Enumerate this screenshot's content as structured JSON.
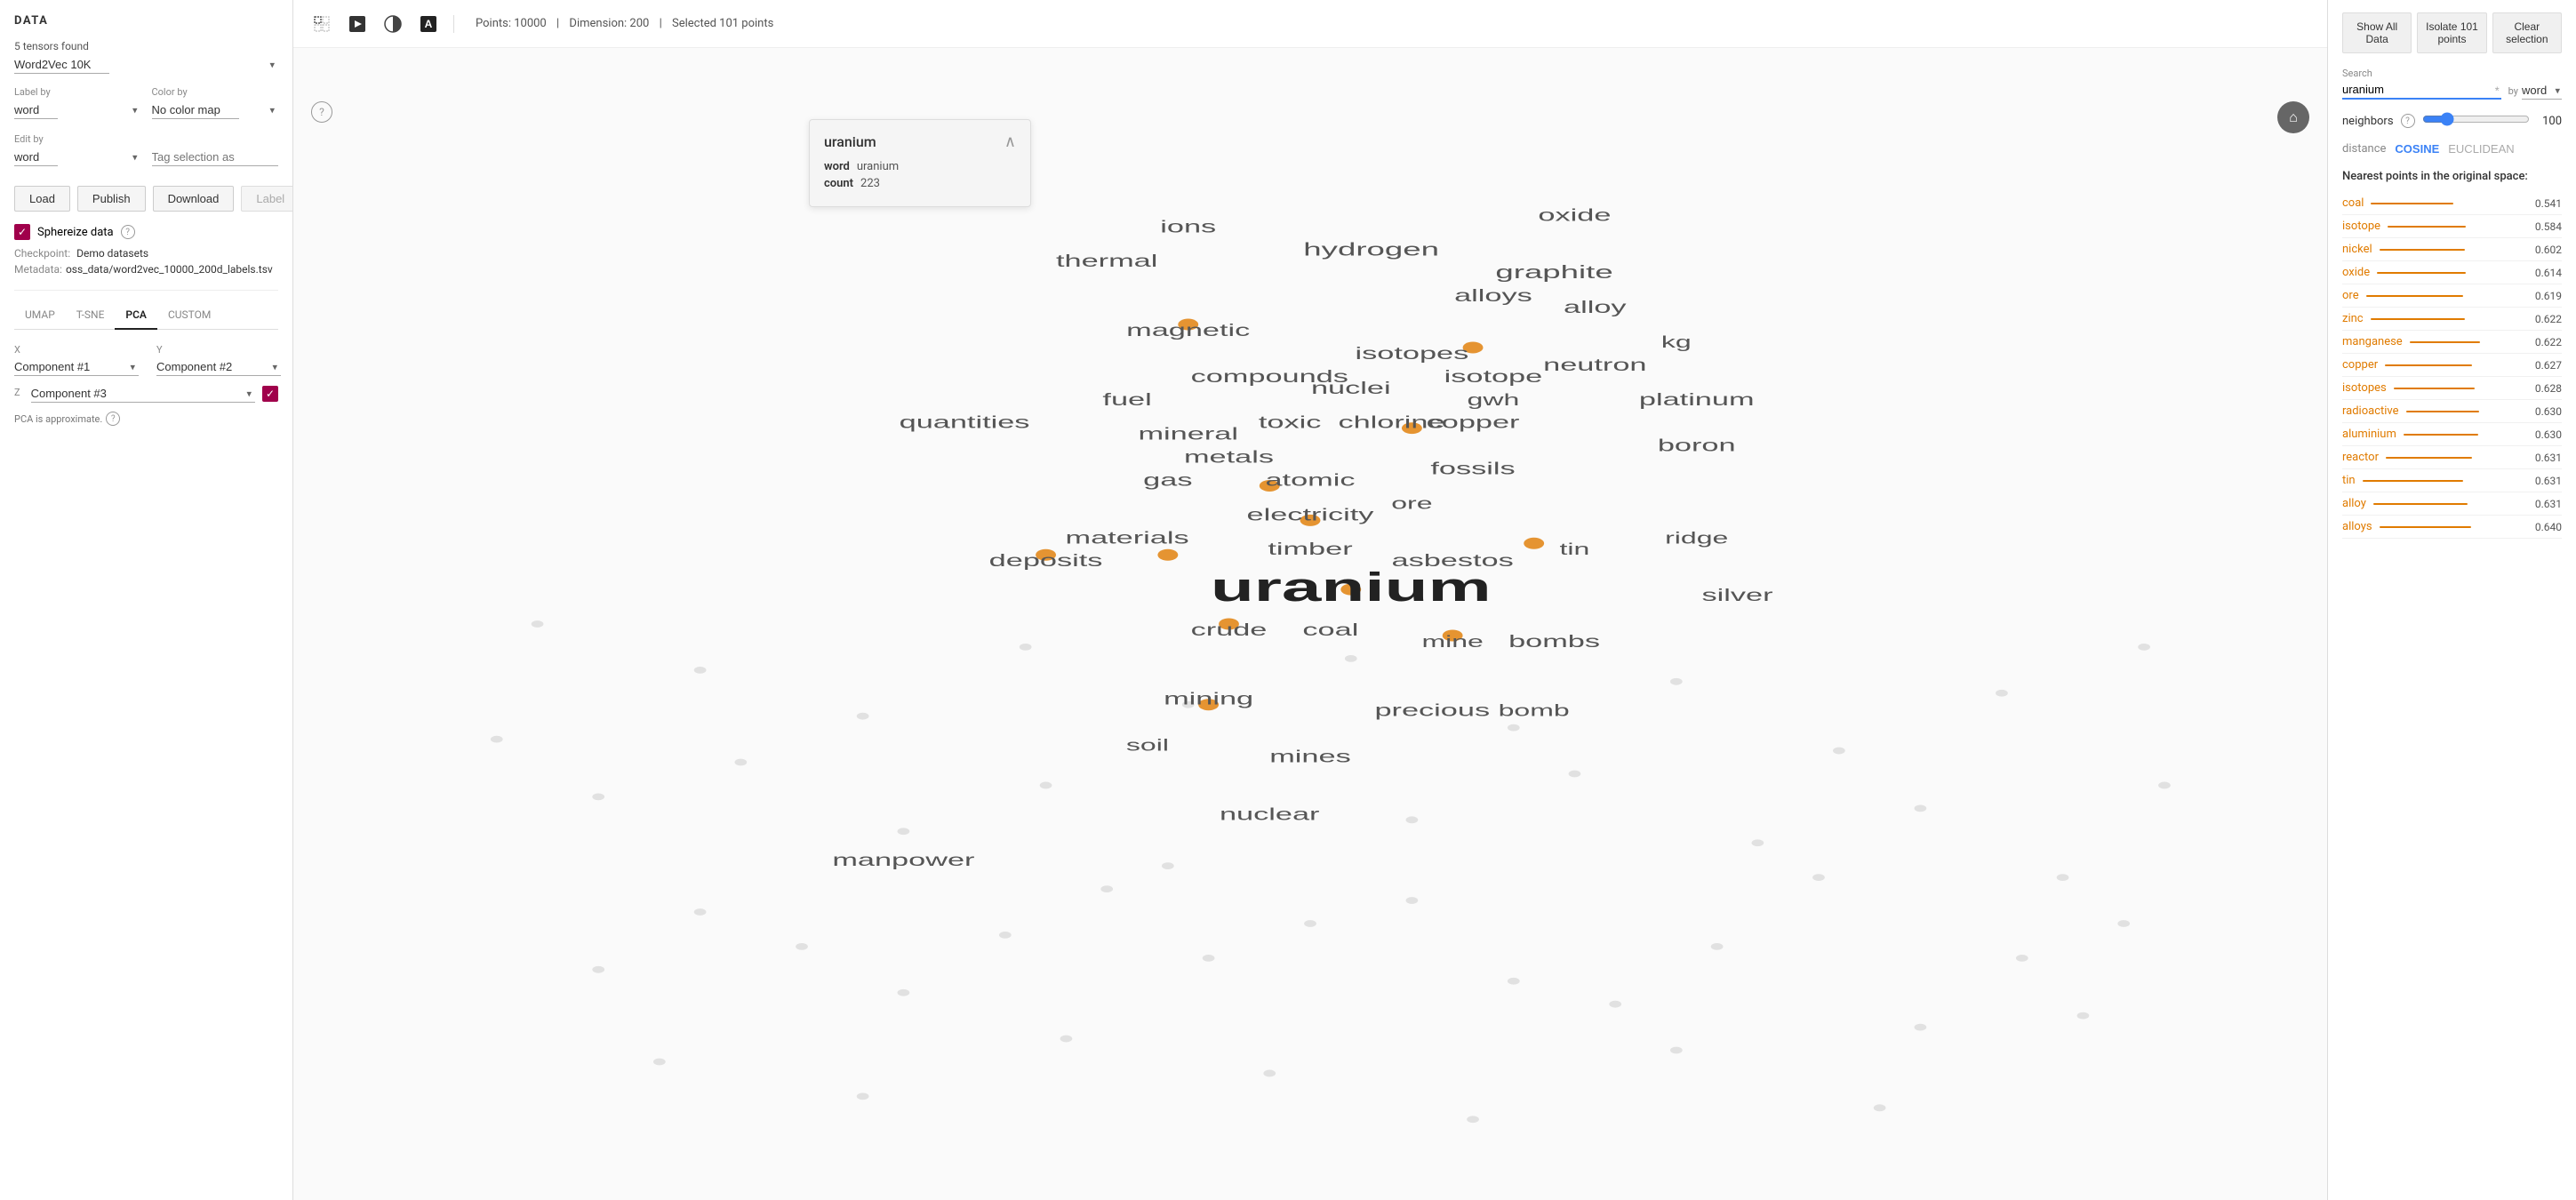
{
  "left": {
    "title": "DATA",
    "tensors_found": "5 tensors found",
    "dataset": "Word2Vec 10K",
    "label_by_label": "Label by",
    "label_by_value": "word",
    "color_by_label": "Color by",
    "color_by_value": "No color map",
    "edit_by_label": "Edit by",
    "edit_by_value": "word",
    "tag_placeholder": "Tag selection as",
    "buttons": {
      "load": "Load",
      "publish": "Publish",
      "download": "Download",
      "label": "Label"
    },
    "sphereize": "Sphereize data",
    "checkpoint_label": "Checkpoint:",
    "checkpoint_value": "Demo datasets",
    "metadata_label": "Metadata:",
    "metadata_value": "oss_data/word2vec_10000_200d_labels.tsv",
    "tabs": [
      "UMAP",
      "T-SNE",
      "PCA",
      "CUSTOM"
    ],
    "active_tab": "PCA",
    "x_label": "X",
    "x_value": "Component #1",
    "y_label": "Y",
    "y_value": "Component #2",
    "z_label": "Z",
    "z_value": "Component #3",
    "approx_note": "PCA is approximate."
  },
  "toolbar": {
    "points_info": "Points: 10000",
    "dimension_info": "Dimension: 200",
    "selected_info": "Selected 101 points"
  },
  "popup": {
    "title": "uranium",
    "word_label": "word",
    "word_value": "uranium",
    "count_label": "count",
    "count_value": "223"
  },
  "scatter": {
    "words": [
      {
        "text": "uranium",
        "x": 52,
        "y": 47,
        "size": 28,
        "bold": true
      },
      {
        "text": "graphite",
        "x": 62,
        "y": 21,
        "size": 12,
        "bold": false
      },
      {
        "text": "hydrogen",
        "x": 53,
        "y": 19,
        "size": 11,
        "bold": false
      },
      {
        "text": "ions",
        "x": 44,
        "y": 16,
        "size": 11,
        "bold": false
      },
      {
        "text": "oxide",
        "x": 63,
        "y": 15,
        "size": 11,
        "bold": false
      },
      {
        "text": "thermal",
        "x": 40,
        "y": 19,
        "size": 11,
        "bold": false
      },
      {
        "text": "alloys",
        "x": 58,
        "y": 21,
        "size": 11,
        "bold": false
      },
      {
        "text": "alloy",
        "x": 63,
        "y": 22,
        "size": 11,
        "bold": false
      },
      {
        "text": "kg",
        "x": 67,
        "y": 25,
        "size": 11,
        "bold": false
      },
      {
        "text": "magnetic",
        "x": 44,
        "y": 24,
        "size": 11,
        "bold": false
      },
      {
        "text": "compounds",
        "x": 48,
        "y": 28,
        "size": 11,
        "bold": false
      },
      {
        "text": "nuclei",
        "x": 52,
        "y": 29,
        "size": 11,
        "bold": false
      },
      {
        "text": "isotopes",
        "x": 55,
        "y": 26,
        "size": 11,
        "bold": false
      },
      {
        "text": "isotope",
        "x": 58,
        "y": 28,
        "size": 11,
        "bold": false
      },
      {
        "text": "neutron",
        "x": 63,
        "y": 27,
        "size": 11,
        "bold": false
      },
      {
        "text": "fuel",
        "x": 41,
        "y": 30,
        "size": 11,
        "bold": false
      },
      {
        "text": "mineral",
        "x": 44,
        "y": 33,
        "size": 11,
        "bold": false
      },
      {
        "text": "toxic",
        "x": 49,
        "y": 32,
        "size": 11,
        "bold": false
      },
      {
        "text": "chlorine",
        "x": 54,
        "y": 32,
        "size": 11,
        "bold": false
      },
      {
        "text": "copper",
        "x": 57,
        "y": 32,
        "size": 11,
        "bold": false
      },
      {
        "text": "platinum",
        "x": 68,
        "y": 30,
        "size": 11,
        "bold": false
      },
      {
        "text": "metals",
        "x": 46,
        "y": 35,
        "size": 11,
        "bold": false
      },
      {
        "text": "gwh",
        "x": 59,
        "y": 30,
        "size": 11,
        "bold": false
      },
      {
        "text": "gas",
        "x": 43,
        "y": 37,
        "size": 11,
        "bold": false
      },
      {
        "text": "atomic",
        "x": 50,
        "y": 37,
        "size": 11,
        "bold": false
      },
      {
        "text": "fossils",
        "x": 58,
        "y": 36,
        "size": 11,
        "bold": false
      },
      {
        "text": "boron",
        "x": 68,
        "y": 34,
        "size": 11,
        "bold": false
      },
      {
        "text": "electricity",
        "x": 50,
        "y": 40,
        "size": 11,
        "bold": false
      },
      {
        "text": "ore",
        "x": 55,
        "y": 39,
        "size": 11,
        "bold": false
      },
      {
        "text": "materials",
        "x": 42,
        "y": 42,
        "size": 11,
        "bold": false
      },
      {
        "text": "timber",
        "x": 50,
        "y": 43,
        "size": 11,
        "bold": false
      },
      {
        "text": "asbestos",
        "x": 57,
        "y": 44,
        "size": 11,
        "bold": false
      },
      {
        "text": "tin",
        "x": 63,
        "y": 43,
        "size": 11,
        "bold": false
      },
      {
        "text": "ridge",
        "x": 68,
        "y": 42,
        "size": 11,
        "bold": false
      },
      {
        "text": "silver",
        "x": 70,
        "y": 47,
        "size": 11,
        "bold": false
      },
      {
        "text": "quantities",
        "x": 33,
        "y": 32,
        "size": 11,
        "bold": false
      },
      {
        "text": "deposits",
        "x": 37,
        "y": 44,
        "size": 11,
        "bold": false
      },
      {
        "text": "crude",
        "x": 46,
        "y": 50,
        "size": 11,
        "bold": false
      },
      {
        "text": "coal",
        "x": 51,
        "y": 50,
        "size": 11,
        "bold": false
      },
      {
        "text": "mine",
        "x": 57,
        "y": 51,
        "size": 11,
        "bold": false
      },
      {
        "text": "bombs",
        "x": 61,
        "y": 51,
        "size": 11,
        "bold": false
      },
      {
        "text": "mining",
        "x": 45,
        "y": 56,
        "size": 11,
        "bold": false
      },
      {
        "text": "precious",
        "x": 56,
        "y": 57,
        "size": 11,
        "bold": false
      },
      {
        "text": "bomb",
        "x": 61,
        "y": 57,
        "size": 11,
        "bold": false
      },
      {
        "text": "soil",
        "x": 42,
        "y": 60,
        "size": 11,
        "bold": false
      },
      {
        "text": "mines",
        "x": 50,
        "y": 61,
        "size": 11,
        "bold": false
      },
      {
        "text": "nuclear",
        "x": 48,
        "y": 66,
        "size": 11,
        "bold": false
      },
      {
        "text": "manpower",
        "x": 30,
        "y": 70,
        "size": 11,
        "bold": false
      }
    ]
  },
  "right": {
    "show_all_label": "Show All Data",
    "isolate_label": "Isolate 101 points",
    "clear_label": "Clear selection",
    "search_label": "Search",
    "search_value": "uranium",
    "by_label": "by",
    "by_value": "word",
    "neighbors_label": "neighbors",
    "neighbors_value": "100",
    "distance_label": "distance",
    "cosine_label": "COSINE",
    "euclidean_label": "EUCLIDEAN",
    "nearest_title": "Nearest points in the original space:",
    "nearest_points": [
      {
        "name": "coal",
        "value": "0.541",
        "bar_pct": 54
      },
      {
        "name": "isotope",
        "value": "0.584",
        "bar_pct": 58
      },
      {
        "name": "nickel",
        "value": "0.602",
        "bar_pct": 60
      },
      {
        "name": "oxide",
        "value": "0.614",
        "bar_pct": 61
      },
      {
        "name": "ore",
        "value": "0.619",
        "bar_pct": 62
      },
      {
        "name": "zinc",
        "value": "0.622",
        "bar_pct": 62
      },
      {
        "name": "manganese",
        "value": "0.622",
        "bar_pct": 62
      },
      {
        "name": "copper",
        "value": "0.627",
        "bar_pct": 63
      },
      {
        "name": "isotopes",
        "value": "0.628",
        "bar_pct": 63
      },
      {
        "name": "radioactive",
        "value": "0.630",
        "bar_pct": 63
      },
      {
        "name": "aluminium",
        "value": "0.630",
        "bar_pct": 63
      },
      {
        "name": "reactor",
        "value": "0.631",
        "bar_pct": 63
      },
      {
        "name": "tin",
        "value": "0.631",
        "bar_pct": 63
      },
      {
        "name": "alloy",
        "value": "0.631",
        "bar_pct": 63
      },
      {
        "name": "alloys",
        "value": "0.640",
        "bar_pct": 64
      }
    ]
  }
}
